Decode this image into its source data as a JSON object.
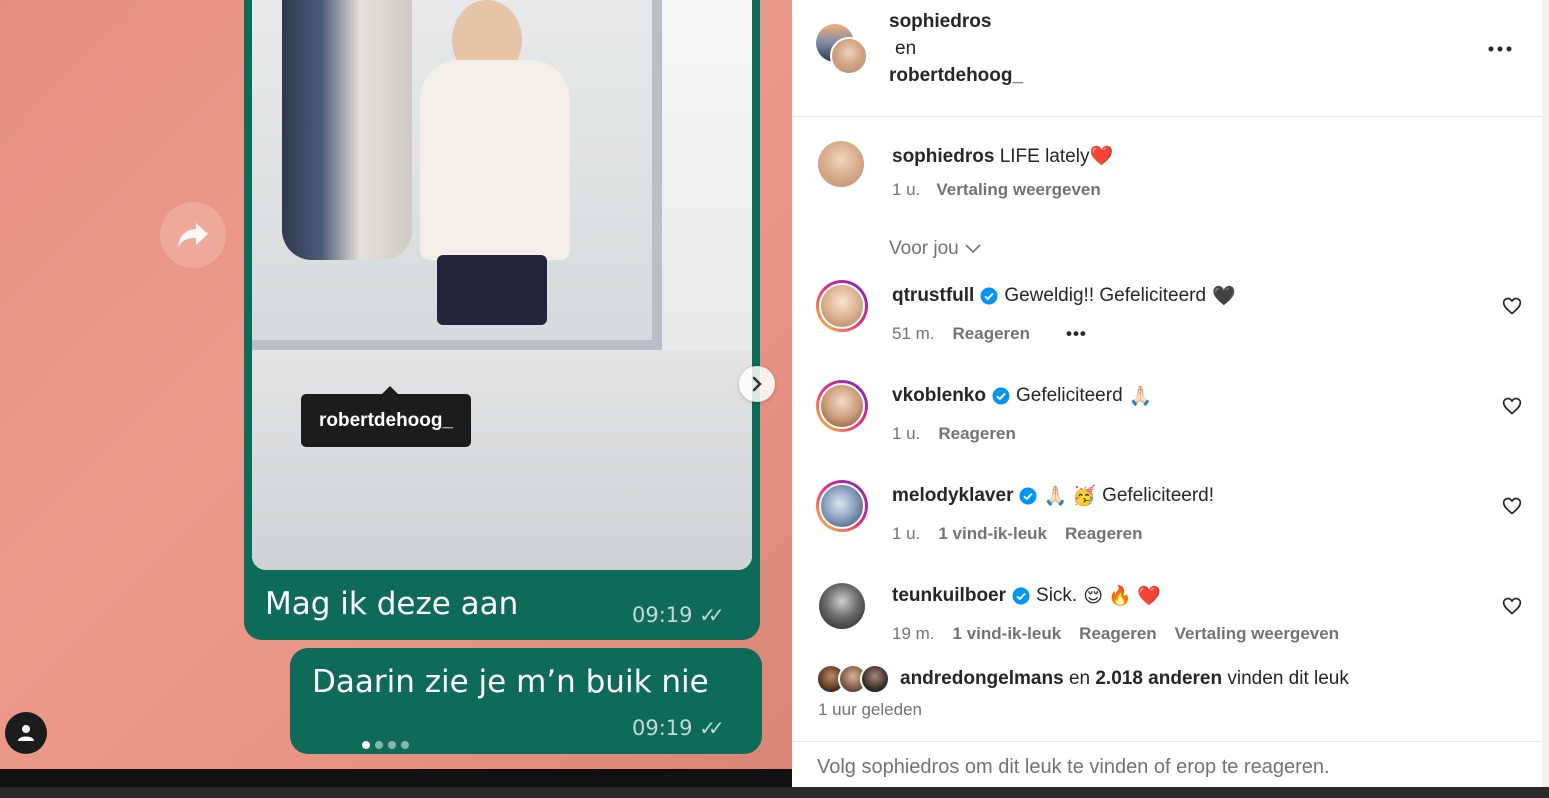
{
  "media": {
    "bubble1_text": "Mag ik deze aan",
    "bubble1_time": "09:19",
    "bubble2_text": "Daarin zie je m’n buik nie",
    "bubble2_time": "09:19",
    "tag_label": "robertdehoog_",
    "slide_count": 4,
    "active_slide": 1
  },
  "header": {
    "author": "sophiedros",
    "joiner": "en",
    "collaborator": "robertdehoog_"
  },
  "caption": {
    "username": "sophiedros",
    "text": "LIFE lately",
    "emoji": "❤️",
    "time": "1 u.",
    "translate": "Vertaling weergeven"
  },
  "voor_jou": "Voor jou",
  "comments": [
    {
      "username": "qtrustfull",
      "text": "Geweldig!! Gefeliciteerd",
      "emoji": "🖤",
      "time": "51 m.",
      "likes": "",
      "reply": "Reageren",
      "translate": "",
      "more": "•••"
    },
    {
      "username": "vkoblenko",
      "text": "Gefeliciteerd",
      "emoji": "🙏🏻",
      "time": "1 u.",
      "likes": "",
      "reply": "Reageren",
      "translate": "",
      "more": ""
    },
    {
      "username": "melodyklaver",
      "text": "Gefeliciteerd!",
      "emoji": "🙏🏻 🥳",
      "time": "1 u.",
      "likes": "1 vind-ik-leuk",
      "reply": "Reageren",
      "translate": "",
      "more": ""
    },
    {
      "username": "teunkuilboer",
      "text": "Sick.",
      "emoji": "😌 🔥 ❤️",
      "time": "19 m.",
      "likes": "1 vind-ik-leuk",
      "reply": "Reageren",
      "translate": "Vertaling weergeven",
      "more": ""
    }
  ],
  "likes": {
    "first_user": "andredongelmans",
    "and_word": "en",
    "others": "2.018 anderen",
    "suffix": "vinden dit leuk"
  },
  "time_ago": "1 uur geleden",
  "footer_text": "Volg sophiedros om dit leuk te vinden of erop te reageren."
}
